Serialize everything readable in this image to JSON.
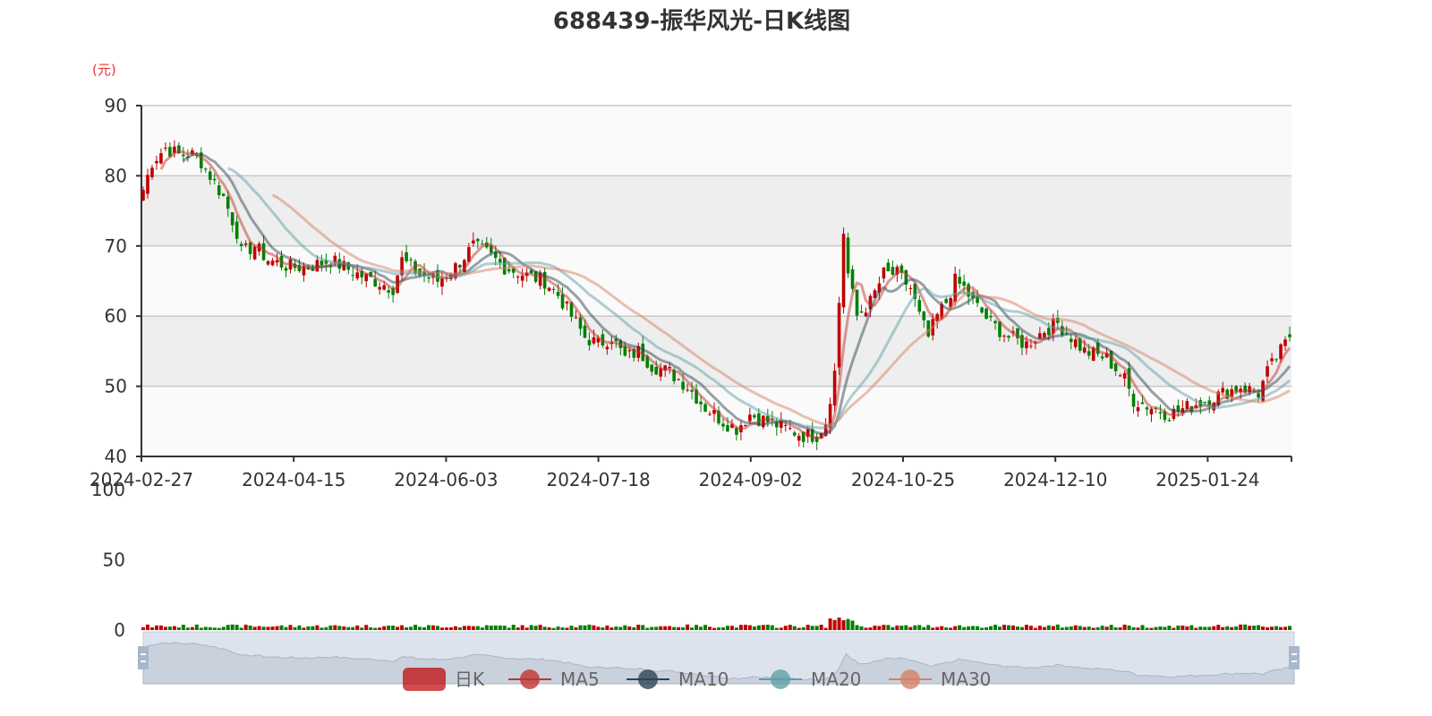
{
  "chart_data": {
    "type": "candlestick",
    "title": "688439-振华风光-日K线图",
    "y_unit": "(元)",
    "ylim": [
      40,
      90
    ],
    "yticks": [
      "90",
      "80",
      "70",
      "60",
      "50",
      "40"
    ],
    "volume_ylim": [
      0,
      100
    ],
    "volume_ticks": [
      "100",
      "50",
      "0"
    ],
    "xticks": [
      "2024-02-27",
      "2024-04-15",
      "2024-06-03",
      "2024-07-18",
      "2024-09-02",
      "2024-10-25",
      "2024-12-10",
      "2025-01-24"
    ],
    "approx_close_keypoints": [
      [
        0,
        78
      ],
      [
        2,
        82
      ],
      [
        5,
        84
      ],
      [
        8,
        83
      ],
      [
        11,
        83
      ],
      [
        13,
        82
      ],
      [
        15,
        80
      ],
      [
        18,
        77
      ],
      [
        21,
        72
      ],
      [
        22,
        69
      ],
      [
        25,
        70
      ],
      [
        28,
        68
      ],
      [
        33,
        67
      ],
      [
        37,
        67
      ],
      [
        42,
        68
      ],
      [
        48,
        66
      ],
      [
        52,
        65
      ],
      [
        56,
        64
      ],
      [
        58,
        68
      ],
      [
        62,
        66
      ],
      [
        66,
        65
      ],
      [
        70,
        67
      ],
      [
        74,
        70
      ],
      [
        77,
        69
      ],
      [
        81,
        67
      ],
      [
        85,
        66
      ],
      [
        90,
        65
      ],
      [
        93,
        63
      ],
      [
        96,
        60
      ],
      [
        99,
        57
      ],
      [
        102,
        56
      ],
      [
        105,
        57
      ],
      [
        108,
        54
      ],
      [
        111,
        55
      ],
      [
        114,
        53
      ],
      [
        118,
        52
      ],
      [
        122,
        50
      ],
      [
        126,
        47
      ],
      [
        130,
        45
      ],
      [
        133,
        44
      ],
      [
        136,
        46
      ],
      [
        140,
        45
      ],
      [
        144,
        44
      ],
      [
        148,
        43
      ],
      [
        151,
        43
      ],
      [
        153,
        45
      ],
      [
        155,
        52
      ],
      [
        157,
        72
      ],
      [
        158,
        66
      ],
      [
        160,
        60
      ],
      [
        163,
        62
      ],
      [
        166,
        66
      ],
      [
        169,
        66
      ],
      [
        172,
        64
      ],
      [
        174,
        60
      ],
      [
        176,
        57
      ],
      [
        178,
        60
      ],
      [
        180,
        62
      ],
      [
        182,
        65
      ],
      [
        184,
        64
      ],
      [
        186,
        62
      ],
      [
        190,
        59
      ],
      [
        194,
        57
      ],
      [
        198,
        56
      ],
      [
        202,
        58
      ],
      [
        205,
        59
      ],
      [
        208,
        57
      ],
      [
        211,
        55
      ],
      [
        216,
        54
      ],
      [
        220,
        51
      ],
      [
        222,
        48
      ],
      [
        226,
        47
      ],
      [
        230,
        46
      ],
      [
        234,
        47
      ],
      [
        238,
        48
      ],
      [
        242,
        49
      ],
      [
        246,
        50
      ],
      [
        250,
        49
      ],
      [
        252,
        52
      ],
      [
        255,
        55
      ],
      [
        257,
        57
      ]
    ],
    "series_names": [
      "日K",
      "MA5",
      "MA10",
      "MA20",
      "MA30"
    ],
    "colors": {
      "up": "#c00000",
      "down": "#008000",
      "ma5": "#c23531",
      "ma10": "#2f4554",
      "ma20": "#61a0a8",
      "ma30": "#d48265"
    }
  }
}
